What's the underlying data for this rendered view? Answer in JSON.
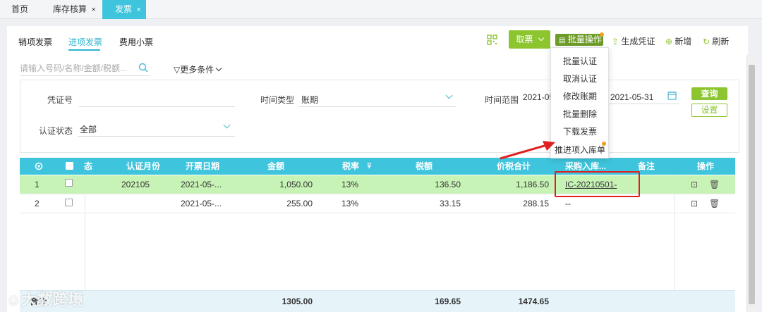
{
  "page_tabs": [
    {
      "label": "首页"
    },
    {
      "label": "库存核算",
      "close": "×"
    },
    {
      "label": "发票",
      "close": "×"
    }
  ],
  "sub_tabs": [
    "销项发票",
    "进项发票",
    "费用小票"
  ],
  "toolbar": {
    "fetch_label": "取票",
    "batch_label": "批量操作",
    "voucher_label": "生成凭证",
    "add_label": "新增",
    "refresh_label": "刷新"
  },
  "search": {
    "placeholder": "请输入号码/名称/金额/税额..."
  },
  "more_conditions": "更多条件",
  "filters": {
    "voucher_no_label": "凭证号",
    "time_type_label": "时间类型",
    "time_type_value": "账期",
    "time_range_label": "时间范围",
    "time_start": "2021-05",
    "time_end": "2021-05-31",
    "auth_status_label": "认证状态",
    "auth_status_value": "全部",
    "query_label": "查询",
    "settings_label": "设置"
  },
  "dropdown": [
    "批量认证",
    "取消认证",
    "修改账期",
    "批量删除",
    "下载发票",
    "推进项入库单"
  ],
  "table": {
    "headers": {
      "status": "态",
      "auth_month": "认证月份",
      "invoice_date": "开票日期",
      "amount": "金额",
      "tax_rate": "税率",
      "tax": "税额",
      "total": "价税合计",
      "purchase": "采购入库...",
      "note": "备注",
      "ops": "操作"
    },
    "rows": [
      {
        "idx": "1",
        "auth_month": "202105",
        "invoice_date": "2021-05-...",
        "amount": "1,050.00",
        "tax_rate": "13%",
        "tax": "136.50",
        "total": "1,186.50",
        "purchase": "IC-20210501-"
      },
      {
        "idx": "2",
        "auth_month": "",
        "invoice_date": "2021-05-...",
        "amount": "255.00",
        "tax_rate": "13%",
        "tax": "33.15",
        "total": "288.15",
        "purchase": "--"
      }
    ],
    "totals": {
      "label": "合计",
      "amount": "1305.00",
      "tax": "169.65",
      "total": "1474.65"
    }
  },
  "watermark": "大数跨境",
  "colors": {
    "accent": "#3ec4dc",
    "green": "#8cc530",
    "olive": "#6d9c28",
    "highlight": "#e02020"
  }
}
